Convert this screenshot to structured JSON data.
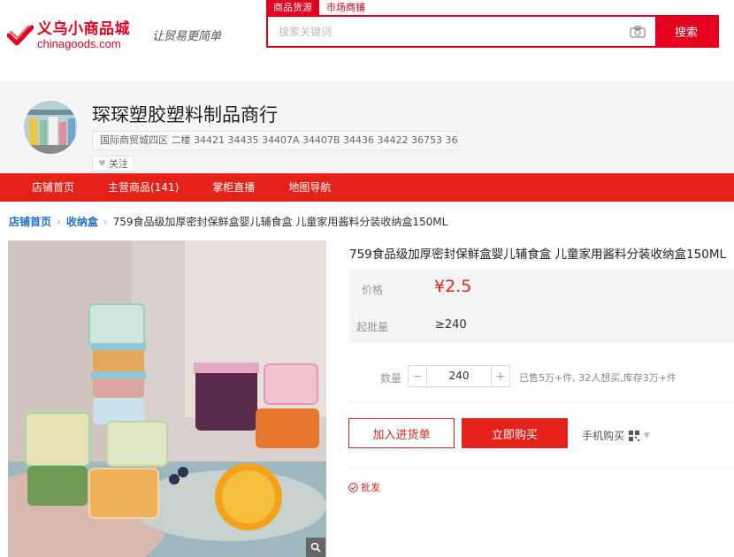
{
  "header": {
    "logo_cn": "义乌小商品城",
    "logo_en": "chinagoods.com",
    "slogan": "让贸易更简单",
    "search_tabs": [
      "商品货源",
      "市场商铺"
    ],
    "search_placeholder": "搜索关键词",
    "search_button": "搜索"
  },
  "shop": {
    "name": "琛琛塑胶塑料制品商行",
    "address": "国际商贸城四区 二楼 34421 34435 34407A 34407B 34436 34422 36753 36...",
    "follow_label": "关注"
  },
  "nav": {
    "items": [
      "店铺首页",
      "主营商品(141)",
      "掌柜直播",
      "地图导航"
    ]
  },
  "breadcrumb": {
    "home": "店铺首页",
    "category": "收纳盒",
    "current": "759食品级加厚密封保鲜盒婴儿辅食盒 儿童家用酱料分装收纳盒150ML"
  },
  "product": {
    "title": "759食品级加厚密封保鲜盒婴儿辅食盒 儿童家用酱料分装收纳盒150ML",
    "price_label": "价格",
    "price": "¥2.5",
    "moq_label": "起批量",
    "moq": "≥240",
    "qty_label": "数量",
    "qty_minus": "−",
    "qty_value": "240",
    "qty_plus": "+",
    "stock_text": "已售5万+件, 32人想买,库存3万+件",
    "add_cart": "加入进货单",
    "buy_now": "立即购买",
    "mobile_buy": "手机购买",
    "batch_tag": "批发"
  },
  "colors": {
    "brand_red": "#e5221a",
    "link_blue": "#1f6fc5"
  }
}
